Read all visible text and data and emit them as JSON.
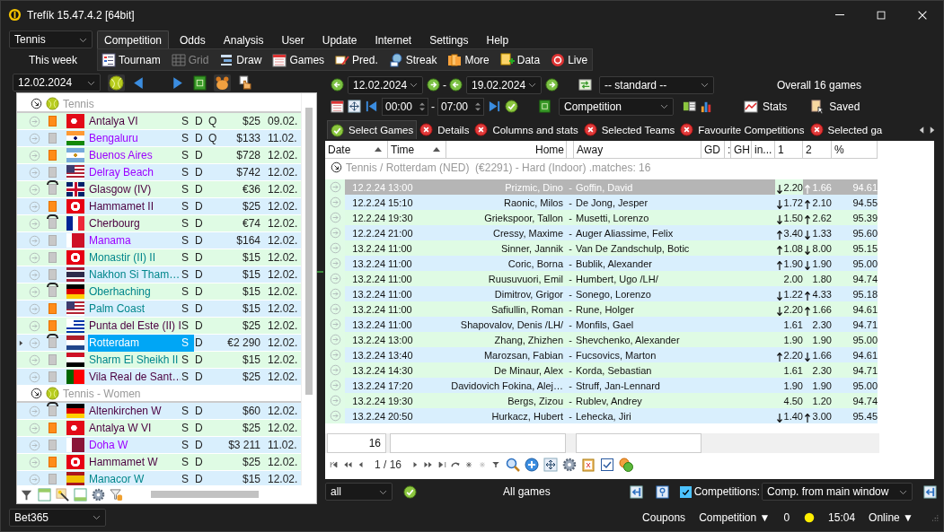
{
  "window": {
    "title": "Trefík 15.47.4.2 [64bit]"
  },
  "sport": "Tennis",
  "menu": [
    {
      "label": "Competition",
      "selected": true
    },
    {
      "label": "Odds",
      "selected": false
    },
    {
      "label": "Analysis",
      "selected": false
    },
    {
      "label": "User",
      "selected": false
    },
    {
      "label": "Update",
      "selected": false
    },
    {
      "label": "Internet",
      "selected": false
    },
    {
      "label": "Settings",
      "selected": false
    },
    {
      "label": "Help",
      "selected": false
    }
  ],
  "period": "This week",
  "toolbar": [
    {
      "label": "Tournam",
      "disabled": false
    },
    {
      "label": "Grid",
      "disabled": true
    },
    {
      "label": "Draw",
      "disabled": false
    },
    {
      "label": "Games",
      "disabled": false
    },
    {
      "label": "Pred.",
      "disabled": false
    },
    {
      "label": "Streak",
      "disabled": false
    },
    {
      "label": "More",
      "disabled": false
    },
    {
      "label": "Data",
      "disabled": false
    },
    {
      "label": "Live",
      "disabled": false
    }
  ],
  "date": "12.02.2024",
  "groups": [
    {
      "title": "Tennis",
      "items": [
        {
          "name": "Antalya VI",
          "kind": "orange",
          "color": "#4b0040",
          "s": "S",
          "d": "D",
          "q": "Q",
          "prize": "$25",
          "date": "09.02.",
          "selected": false
        },
        {
          "name": "Bengaluru",
          "kind": "grey",
          "color": "#9b00ff",
          "s": "S",
          "d": "D",
          "q": "Q",
          "prize": "$133",
          "date": "11.02.",
          "selected": false
        },
        {
          "name": "Buenos Aires",
          "kind": "orange",
          "color": "#9b00ff",
          "s": "S",
          "d": "D",
          "prize": "$728",
          "date": "12.02.",
          "selected": false
        },
        {
          "name": "Delray Beach",
          "kind": "grey",
          "color": "#9b00ff",
          "s": "S",
          "d": "D",
          "prize": "$742",
          "date": "12.02.",
          "selected": false
        },
        {
          "name": "Glasgow (IV)",
          "kind": "cap",
          "color": "#4b0040",
          "s": "S",
          "d": "D",
          "prize": "€36",
          "date": "12.02.",
          "selected": false
        },
        {
          "name": "Hammamet II",
          "kind": "orange",
          "color": "#4b0040",
          "s": "S",
          "d": "D",
          "prize": "$25",
          "date": "12.02.",
          "selected": false
        },
        {
          "name": "Cherbourg",
          "kind": "cap",
          "color": "#4b0040",
          "s": "S",
          "d": "D",
          "prize": "€74",
          "date": "12.02.",
          "selected": false
        },
        {
          "name": "Manama",
          "kind": "grey",
          "color": "#9b00ff",
          "s": "S",
          "d": "D",
          "prize": "$164",
          "date": "12.02.",
          "selected": false
        },
        {
          "name": "Monastir (II) II",
          "kind": "grey",
          "color": "#00868b",
          "s": "S",
          "d": "D",
          "prize": "$15",
          "date": "12.02.",
          "selected": false
        },
        {
          "name": "Nakhon Si Tham…",
          "kind": "grey",
          "color": "#00868b",
          "s": "S",
          "d": "D",
          "prize": "$15",
          "date": "12.02.",
          "selected": false
        },
        {
          "name": "Oberhaching",
          "kind": "cap",
          "color": "#00868b",
          "s": "S",
          "d": "D",
          "prize": "$15",
          "date": "12.02.",
          "selected": false
        },
        {
          "name": "Palm Coast",
          "kind": "orange",
          "color": "#00868b",
          "s": "S",
          "d": "D",
          "prize": "$15",
          "date": "12.02.",
          "selected": false
        },
        {
          "name": "Punta del Este (II) I",
          "kind": "orange",
          "color": "#4b0040",
          "s": "S",
          "d": "D",
          "prize": "$25",
          "date": "12.02.",
          "selected": false
        },
        {
          "name": "Rotterdam",
          "kind": "cap",
          "s": "S",
          "d": "D",
          "prize": "€2 290",
          "date": "12.02.",
          "selected": true
        },
        {
          "name": "Sharm El Sheikh II",
          "kind": "grey",
          "color": "#00868b",
          "s": "S",
          "d": "D",
          "prize": "$15",
          "date": "12.02.",
          "selected": false
        },
        {
          "name": "Vila Real de Sant…",
          "kind": "grey",
          "color": "#4b0040",
          "s": "S",
          "d": "D",
          "prize": "$25",
          "date": "12.02.",
          "selected": false
        }
      ]
    },
    {
      "title": "Tennis - Women",
      "items": [
        {
          "name": "Altenkirchen W",
          "kind": "cap",
          "color": "#4b0040",
          "s": "S",
          "d": "D",
          "prize": "$60",
          "date": "12.02.",
          "selected": false
        },
        {
          "name": "Antalya W VI",
          "kind": "orange",
          "color": "#4b0040",
          "s": "S",
          "d": "D",
          "prize": "$25",
          "date": "12.02.",
          "selected": false
        },
        {
          "name": "Doha W",
          "kind": "grey",
          "color": "#9b00ff",
          "s": "S",
          "d": "D",
          "prize": "$3 211",
          "date": "11.02.",
          "selected": false
        },
        {
          "name": "Hammamet W",
          "kind": "orange",
          "color": "#4b0040",
          "s": "S",
          "d": "D",
          "prize": "$25",
          "date": "12.02.",
          "selected": false
        },
        {
          "name": "Manacor W",
          "kind": "grey",
          "color": "#00868b",
          "s": "S",
          "d": "D",
          "prize": "$15",
          "date": "12.02.",
          "selected": false
        }
      ]
    }
  ],
  "bookmaker": "Bet365",
  "range": {
    "from": "12.02.2024",
    "dash": "-",
    "to": "19.02.2024",
    "preset": "-- standard --",
    "time_from": "00:00",
    "dash2": "-",
    "time_to": "07:00",
    "filter": "Competition",
    "summary": "Overall 16 games",
    "stats": "Stats",
    "saved": "Saved"
  },
  "subtabs": [
    {
      "label": "Select Games",
      "selected": true
    },
    {
      "label": "Details",
      "selected": false
    },
    {
      "label": "Columns and stats",
      "selected": false
    },
    {
      "label": "Selected Teams",
      "selected": false
    },
    {
      "label": "Favourite Competitions",
      "selected": false
    },
    {
      "label": "Selected ga",
      "selected": false
    }
  ],
  "table": {
    "columns": [
      "Date",
      "Time",
      "Home",
      "",
      "Away",
      "GD",
      ":",
      "GH",
      "in...",
      "1",
      "2",
      "%"
    ],
    "group": "Tennis / Rotterdam (NED)  (€2291) - Hard (Indoor) .matches: 16",
    "rows": [
      {
        "date": "12.2.24",
        "time": "13:00",
        "home": "Prizmic, Dino",
        "sep": "-",
        "away": "Goffin, David",
        "o1": "2.20",
        "up1": false,
        "down1": true,
        "o2": "1.66",
        "up2": true,
        "down2": false,
        "pct": "94.61",
        "selected": true
      },
      {
        "date": "12.2.24",
        "time": "15:10",
        "home": "Raonic, Milos",
        "sep": "-",
        "away": "De Jong, Jesper",
        "o1": "1.72",
        "up1": false,
        "down1": true,
        "o2": "2.10",
        "up2": true,
        "down2": false,
        "pct": "94.55",
        "selected": false
      },
      {
        "date": "12.2.24",
        "time": "19:30",
        "home": "Griekspoor, Tallon",
        "sep": "-",
        "away": "Musetti, Lorenzo",
        "o1": "1.50",
        "up1": false,
        "down1": true,
        "o2": "2.62",
        "up2": true,
        "down2": false,
        "pct": "95.39",
        "selected": false
      },
      {
        "date": "12.2.24",
        "time": "21:00",
        "home": "Cressy, Maxime",
        "sep": "-",
        "away": "Auger Aliassime, Felix",
        "o1": "3.40",
        "up1": true,
        "down1": false,
        "o2": "1.33",
        "up2": false,
        "down2": true,
        "pct": "95.60",
        "selected": false
      },
      {
        "date": "13.2.24",
        "time": "11:00",
        "home": "Sinner, Jannik",
        "sep": "-",
        "away": "Van De Zandschulp, Botic",
        "o1": "1.08",
        "up1": true,
        "down1": false,
        "o2": "8.00",
        "up2": false,
        "down2": true,
        "pct": "95.15",
        "selected": false
      },
      {
        "date": "13.2.24",
        "time": "11:00",
        "home": "Coric, Borna",
        "sep": "-",
        "away": "Bublik, Alexander",
        "o1": "1.90",
        "up1": true,
        "down1": false,
        "o2": "1.90",
        "up2": false,
        "down2": true,
        "pct": "95.00",
        "selected": false
      },
      {
        "date": "13.2.24",
        "time": "11:00",
        "home": "Ruusuvuori, Emil",
        "sep": "-",
        "away": "Humbert, Ugo /LH/",
        "o1": "2.00",
        "up1": false,
        "down1": false,
        "o2": "1.80",
        "up2": false,
        "down2": false,
        "pct": "94.74",
        "selected": false
      },
      {
        "date": "13.2.24",
        "time": "11:00",
        "home": "Dimitrov, Grigor",
        "sep": "-",
        "away": "Sonego, Lorenzo",
        "o1": "1.22",
        "up1": false,
        "down1": true,
        "o2": "4.33",
        "up2": true,
        "down2": false,
        "pct": "95.18",
        "selected": false
      },
      {
        "date": "13.2.24",
        "time": "11:00",
        "home": "Safiullin, Roman",
        "sep": "-",
        "away": "Rune, Holger",
        "o1": "2.20",
        "up1": false,
        "down1": true,
        "o2": "1.66",
        "up2": true,
        "down2": false,
        "pct": "94.61",
        "selected": false
      },
      {
        "date": "13.2.24",
        "time": "11:00",
        "home": "Shapovalov, Denis /LH/",
        "sep": "-",
        "away": "Monfils, Gael",
        "o1": "1.61",
        "up1": false,
        "down1": false,
        "o2": "2.30",
        "up2": false,
        "down2": false,
        "pct": "94.71",
        "selected": false
      },
      {
        "date": "13.2.24",
        "time": "13:00",
        "home": "Zhang, Zhizhen",
        "sep": "-",
        "away": "Shevchenko, Alexander",
        "o1": "1.90",
        "up1": false,
        "down1": false,
        "o2": "1.90",
        "up2": false,
        "down2": false,
        "pct": "95.00",
        "selected": false
      },
      {
        "date": "13.2.24",
        "time": "13:40",
        "home": "Marozsan, Fabian",
        "sep": "-",
        "away": "Fucsovics, Marton",
        "o1": "2.20",
        "up1": true,
        "down1": false,
        "o2": "1.66",
        "up2": false,
        "down2": true,
        "pct": "94.61",
        "selected": false
      },
      {
        "date": "13.2.24",
        "time": "14:30",
        "home": "De Minaur, Alex",
        "sep": "-",
        "away": "Korda, Sebastian",
        "o1": "1.61",
        "up1": false,
        "down1": false,
        "o2": "2.30",
        "up2": false,
        "down2": false,
        "pct": "94.71",
        "selected": false
      },
      {
        "date": "13.2.24",
        "time": "17:20",
        "home": "Davidovich Fokina, Alej…",
        "sep": "-",
        "away": "Struff, Jan-Lennard",
        "o1": "1.90",
        "up1": false,
        "down1": false,
        "o2": "1.90",
        "up2": false,
        "down2": false,
        "pct": "95.00",
        "selected": false
      },
      {
        "date": "13.2.24",
        "time": "19:30",
        "home": "Bergs, Zizou",
        "sep": "-",
        "away": "Rublev, Andrey",
        "o1": "4.50",
        "up1": false,
        "down1": false,
        "o2": "1.20",
        "up2": false,
        "down2": false,
        "pct": "94.74",
        "selected": false
      },
      {
        "date": "13.2.24",
        "time": "20:50",
        "home": "Hurkacz, Hubert",
        "sep": "-",
        "away": "Lehecka, Jiri",
        "o1": "1.40",
        "up1": false,
        "down1": true,
        "o2": "3.00",
        "up2": true,
        "down2": false,
        "pct": "95.45",
        "selected": false
      }
    ],
    "count": "16",
    "pager": "1 / 16"
  },
  "bottom": {
    "filter": "all",
    "label": "All games",
    "checked": true,
    "competitions": "Competitions:",
    "source": "Comp. from main window"
  },
  "status": {
    "coupons": "Coupons",
    "mode": "Competition ▼",
    "count": "0",
    "time": "15:04",
    "online": "Online ▼"
  }
}
